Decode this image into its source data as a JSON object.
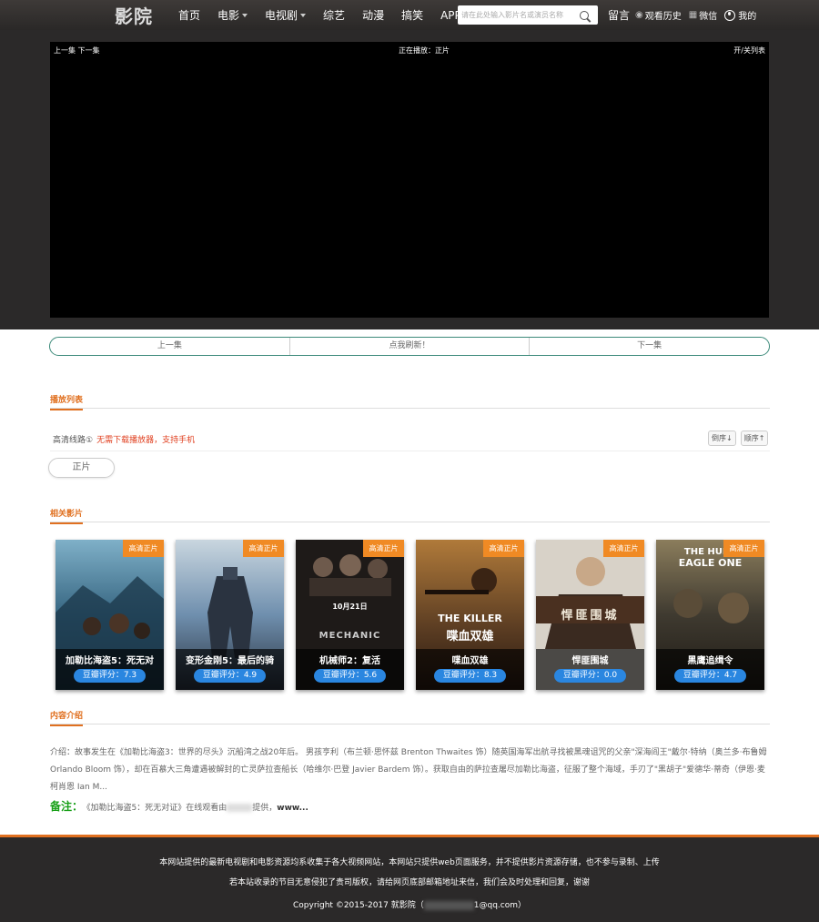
{
  "header": {
    "logo": "影院",
    "nav": [
      {
        "label": "首页",
        "dropdown": false
      },
      {
        "label": "电影",
        "dropdown": true
      },
      {
        "label": "电视剧",
        "dropdown": true
      },
      {
        "label": "综艺",
        "dropdown": false
      },
      {
        "label": "动漫",
        "dropdown": false
      },
      {
        "label": "搞笑",
        "dropdown": false
      },
      {
        "label": "APP",
        "dropdown": false
      }
    ],
    "search_placeholder": "请在此处输入影片名或演员名称",
    "links": {
      "message": "留言",
      "history": "观看历史",
      "wechat": "微信",
      "mine": "我的"
    }
  },
  "player": {
    "prev_next": "上一集 下一集",
    "now_playing": "正在播放：正片",
    "toggle": "开/关列表"
  },
  "episode_nav": {
    "prev": "上一集",
    "refresh": "点我刷新！",
    "next": "下一集"
  },
  "playlist": {
    "heading": "播放列表",
    "line_name": "高清线路①",
    "line_note": "无需下载播放器，支持手机",
    "sort_desc": "倒序↓",
    "sort_asc": "顺序↑",
    "episode": "正片"
  },
  "related": {
    "heading": "相关影片",
    "movies": [
      {
        "title": "加勒比海盗5：死无对",
        "badge": "高清正片",
        "score": "豆瓣评分：7.3",
        "colors": [
          "#2f5e7a",
          "#7fb0c8",
          "#1c2e3a"
        ]
      },
      {
        "title": "变形金刚5：最后的骑",
        "badge": "高清正片",
        "score": "豆瓣评分：4.9",
        "colors": [
          "#6f8fae",
          "#c9d6df",
          "#2a3340"
        ]
      },
      {
        "title": "机械师2：复活",
        "badge": "高清正片",
        "score": "豆瓣评分：5.6",
        "colors": [
          "#2a2422",
          "#6e5a4c",
          "#111"
        ]
      },
      {
        "title": "喋血双雄",
        "badge": "高清正片",
        "score": "豆瓣评分：8.3",
        "colors": [
          "#5a3c22",
          "#b07a3a",
          "#2a1a10"
        ]
      },
      {
        "title": "悍匪围城",
        "badge": "高清正片",
        "score": "豆瓣评分：0.0",
        "colors": [
          "#d8d2c8",
          "#a89f90",
          "#3a2a20"
        ]
      },
      {
        "title": "黑鹰追缉令",
        "badge": "高清正片",
        "score": "豆瓣评分：4.7",
        "colors": [
          "#3f3a30",
          "#8b7d5c",
          "#1e1a14"
        ]
      }
    ],
    "poster_texts": {
      "mechanic_date": "10月21日",
      "mechanic_brand": "MECHANIC",
      "killer_en": "THE KILLER",
      "killer_cn": "喋血双雄",
      "city_cn": "悍匪围城",
      "hunt_en1": "THE HUNT",
      "hunt_en2": "EAGLE ONE"
    }
  },
  "intro": {
    "heading": "内容介绍",
    "text": "介绍：故事发生在《加勒比海盗3：世界的尽头》沉船湾之战20年后。 男孩亨利（布兰顿·思怀兹 Brenton Thwaites 饰）随英国海军出航寻找被黑魂诅咒的父亲\"深海阎王\"戴尔·特纳（奥兰多·布鲁姆 Orlando Bloom 饰），却在百慕大三角遭遇被解封的亡灵萨拉查船长（哈维尔·巴登 Javier Bardem 饰）。获取自由的萨拉查屠尽加勒比海盗，征服了整个海域，手刃了\"黑胡子\"爱德华·蒂奇（伊恩·麦柯肖恩 Ian M...",
    "note_label": "备注：",
    "note_text": "《加勒比海盗5：死无对证》在线观看由",
    "note_text2": "提供，",
    "note_site": "www..."
  },
  "footer": {
    "line1": "本网站提供的最新电视剧和电影资源均系收集于各大视频网站，本网站只提供web页面服务，并不提供影片资源存储，也不参与录制、上传",
    "line2": "若本站收录的节目无意侵犯了贵司版权，请给网页底部邮箱地址来信，我们会及时处理和回复，谢谢",
    "copyright": "Copyright ©2015-2017 就影院（",
    "email_suffix": "1@qq.com）"
  }
}
